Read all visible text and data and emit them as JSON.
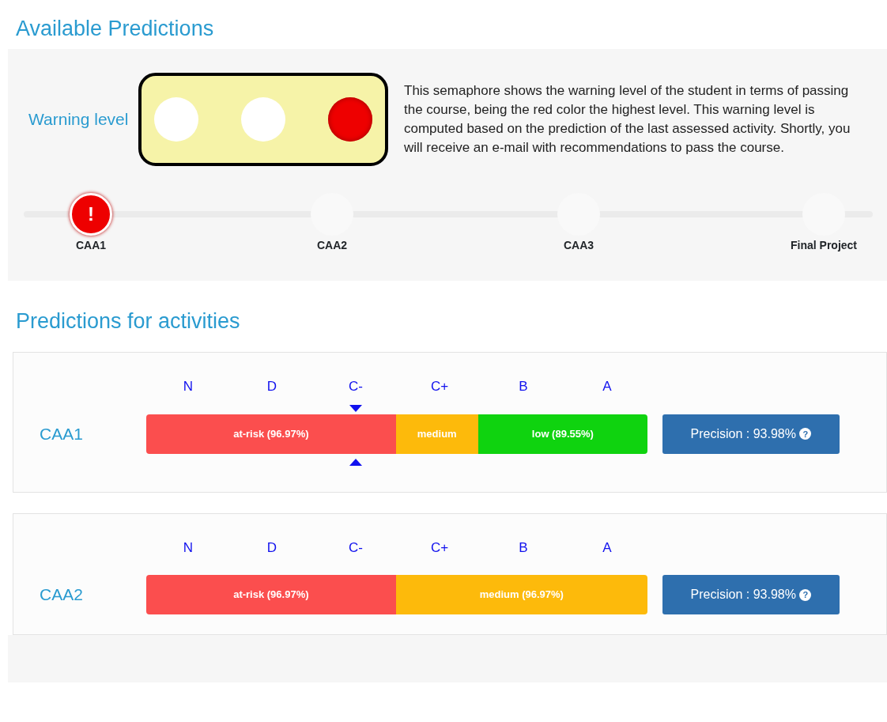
{
  "title": "Available Predictions",
  "warning": {
    "label": "Warning level",
    "lights": [
      {
        "on": false
      },
      {
        "on": false
      },
      {
        "on": true
      }
    ],
    "description": "This semaphore shows the warning level of the student in terms of passing the course, being the red color the highest level. This warning level is computed based on the prediction of the last assessed activity. Shortly, you will receive an e-mail with recommendations to pass the course."
  },
  "timeline": {
    "alert_symbol": "!",
    "items": [
      {
        "label": "CAA1",
        "alert": true
      },
      {
        "label": "CAA2",
        "alert": false
      },
      {
        "label": "CAA3",
        "alert": false
      },
      {
        "label": "Final Project",
        "alert": false
      }
    ]
  },
  "activities_title": "Predictions for activities",
  "activities": [
    {
      "name": "CAA1",
      "grades": [
        {
          "label": "N",
          "selected": false
        },
        {
          "label": "D",
          "selected": false
        },
        {
          "label": "C-",
          "selected": true
        },
        {
          "label": "C+",
          "selected": false
        },
        {
          "label": "B",
          "selected": false
        },
        {
          "label": "A",
          "selected": false
        }
      ],
      "segments": [
        {
          "kind": "at-risk",
          "label": "at-risk (96.97%)"
        },
        {
          "kind": "medium",
          "label": "medium"
        },
        {
          "kind": "low",
          "label": "low (89.55%)"
        }
      ],
      "precision": "Precision : 93.98%",
      "help_symbol": "?"
    },
    {
      "name": "CAA2",
      "grades": [
        {
          "label": "N",
          "selected": false
        },
        {
          "label": "D",
          "selected": false
        },
        {
          "label": "C-",
          "selected": false
        },
        {
          "label": "C+",
          "selected": false
        },
        {
          "label": "B",
          "selected": false
        },
        {
          "label": "A",
          "selected": false
        }
      ],
      "segments": [
        {
          "kind": "at-risk",
          "label": "at-risk (96.97%)"
        },
        {
          "kind": "medium",
          "label": "medium (96.97%)"
        }
      ],
      "precision": "Precision : 93.98%",
      "help_symbol": "?"
    }
  ]
}
